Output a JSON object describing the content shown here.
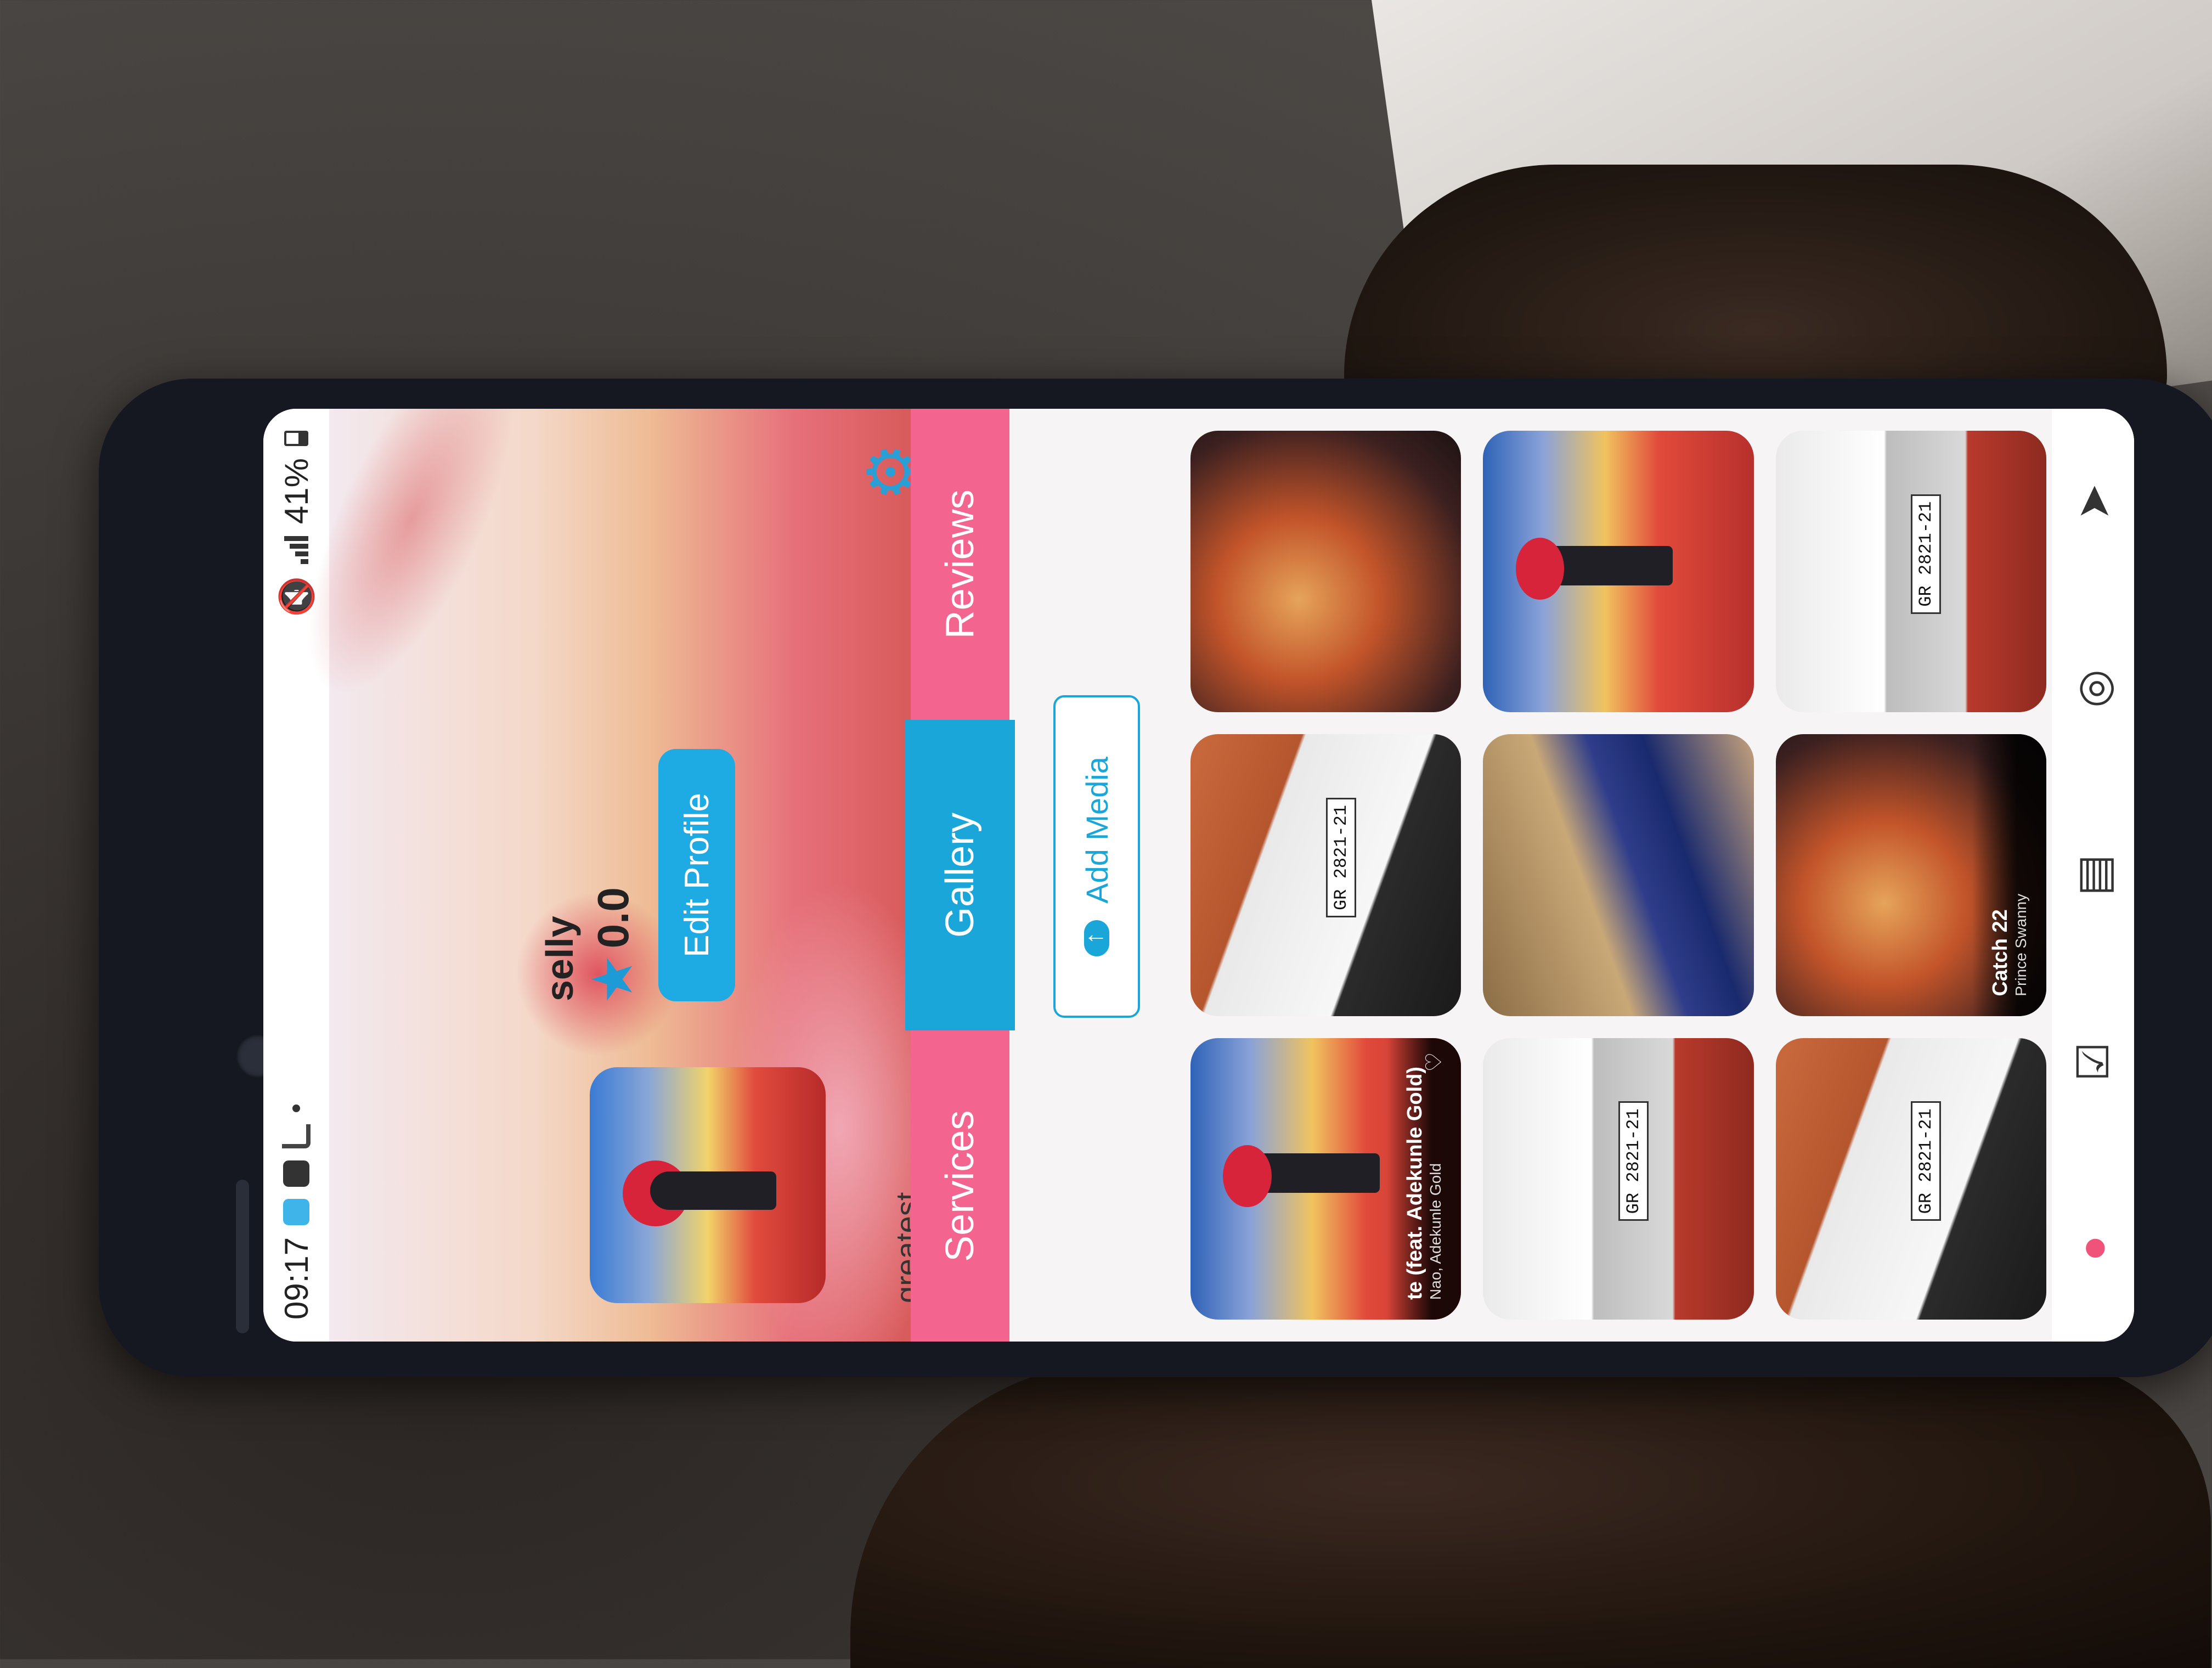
{
  "status_bar": {
    "time": "09:17",
    "battery": "41%"
  },
  "profile": {
    "name": "selly",
    "rating": "0.0",
    "edit_label": "Edit Profile",
    "bio": "greatest"
  },
  "tabs": [
    {
      "label": "Services",
      "active": false
    },
    {
      "label": "Gallery",
      "active": true
    },
    {
      "label": "Reviews",
      "active": false
    }
  ],
  "gallery": {
    "add_media_label": "Add Media",
    "items": [
      {
        "kind": "art",
        "title": "te (feat. Adekunle Gold)",
        "subtitle": "Nao, Adekunle Gold"
      },
      {
        "kind": "car",
        "plate": "GR 2821-21"
      },
      {
        "kind": "cover"
      },
      {
        "kind": "car2",
        "plate": "GR 2821-21"
      },
      {
        "kind": "photo"
      },
      {
        "kind": "art"
      },
      {
        "kind": "car",
        "plate": "GR 2821-21"
      },
      {
        "kind": "cover",
        "title": "Catch 22",
        "subtitle": "Prince Swanny"
      },
      {
        "kind": "car2",
        "plate": "GR 2821-21"
      }
    ]
  },
  "bottom_nav": [
    {
      "icon": "profile-icon",
      "active": true
    },
    {
      "icon": "checklist-icon",
      "active": false
    },
    {
      "icon": "document-icon",
      "active": false
    },
    {
      "icon": "coins-icon",
      "active": false
    },
    {
      "icon": "send-icon",
      "active": false
    }
  ],
  "colors": {
    "accent_blue": "#1aa6d8",
    "tab_pink": "#f3648e",
    "nav_active": "#f0537a"
  }
}
